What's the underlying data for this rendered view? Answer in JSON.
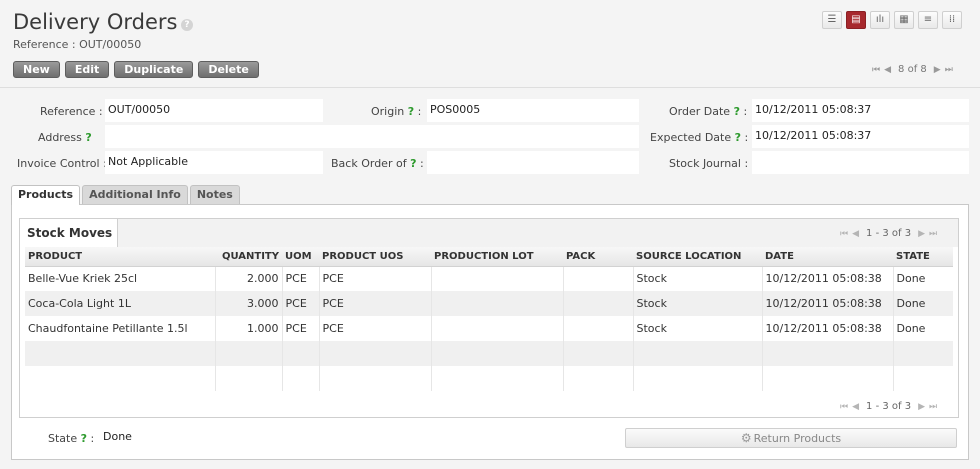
{
  "header": {
    "title": "Delivery Orders",
    "help_glyph": "?",
    "subtitle": "Reference : OUT/00050"
  },
  "view_modes": [
    {
      "icon": "list-view-icon",
      "glyph": "☰",
      "active": false
    },
    {
      "icon": "form-view-icon",
      "glyph": "▤",
      "active": true
    },
    {
      "icon": "graph-view-icon",
      "glyph": "ılı",
      "active": false
    },
    {
      "icon": "calendar-view-icon",
      "glyph": "▦",
      "active": false
    },
    {
      "icon": "gantt-view-icon",
      "glyph": "≡",
      "active": false
    },
    {
      "icon": "kanban-view-icon",
      "glyph": "⁞⁞",
      "active": false
    }
  ],
  "toolbar": {
    "new_label": "New",
    "edit_label": "Edit",
    "duplicate_label": "Duplicate",
    "delete_label": "Delete"
  },
  "pager": {
    "first": "⏮",
    "prev": "◀",
    "text": "8 of 8",
    "next": "▶",
    "last": "⏭"
  },
  "form": {
    "reference_label": "Reference :",
    "reference_value": "OUT/00050",
    "origin_label": "Origin",
    "origin_value": "POS0005",
    "order_date_label": "Order Date",
    "order_date_value": "10/12/2011 05:08:37",
    "address_label": "Address",
    "address_value": "",
    "expected_date_label": "Expected Date",
    "expected_date_value": "10/12/2011 05:08:37",
    "invoice_control_label": "Invoice Control :",
    "invoice_control_value": "Not Applicable",
    "back_order_label": "Back Order of",
    "back_order_value": "",
    "stock_journal_label": "Stock Journal :",
    "stock_journal_value": "",
    "state_label": "State",
    "state_value": "Done",
    "help_mark": "?",
    "colon": ":"
  },
  "tabs": [
    {
      "label": "Products",
      "active": true
    },
    {
      "label": "Additional Info",
      "active": false
    },
    {
      "label": "Notes",
      "active": false
    }
  ],
  "stock_moves": {
    "title": "Stock Moves",
    "pager_text": "1 - 3 of 3",
    "columns": [
      "PRODUCT",
      "QUANTITY",
      "UOM",
      "PRODUCT UOS",
      "PRODUCTION LOT",
      "PACK",
      "SOURCE LOCATION",
      "DATE",
      "STATE"
    ],
    "rows": [
      [
        "Belle-Vue Kriek 25cl",
        "2.000",
        "PCE",
        "PCE",
        "",
        "",
        "Stock",
        "10/12/2011 05:08:38",
        "Done"
      ],
      [
        "Coca-Cola Light 1L",
        "3.000",
        "PCE",
        "PCE",
        "",
        "",
        "Stock",
        "10/12/2011 05:08:38",
        "Done"
      ],
      [
        "Chaudfontaine Petillante 1.5l",
        "1.000",
        "PCE",
        "PCE",
        "",
        "",
        "Stock",
        "10/12/2011 05:08:38",
        "Done"
      ],
      [
        "",
        "",
        "",
        "",
        "",
        "",
        "",
        "",
        ""
      ],
      [
        "",
        "",
        "",
        "",
        "",
        "",
        "",
        "",
        ""
      ]
    ]
  },
  "return_button": {
    "icon": "gears-icon",
    "glyph": "⚙",
    "label": "Return Products"
  }
}
